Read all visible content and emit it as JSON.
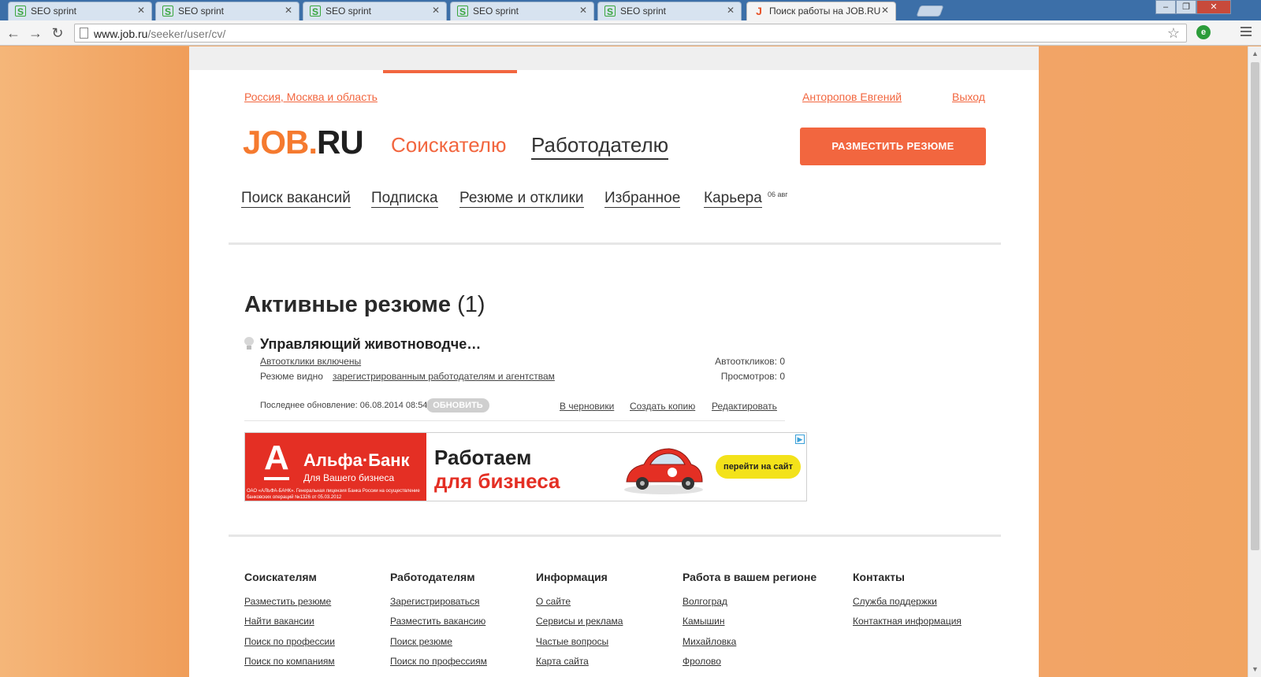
{
  "browser": {
    "tabs": [
      {
        "title": "SEO sprint",
        "favicon": "seosprint-icon"
      },
      {
        "title": "SEO sprint",
        "favicon": "seosprint-icon"
      },
      {
        "title": "SEO sprint",
        "favicon": "seosprint-icon"
      },
      {
        "title": "SEO sprint",
        "favicon": "seosprint-icon"
      },
      {
        "title": "SEO sprint",
        "favicon": "seosprint-icon"
      },
      {
        "title": "Поиск работы на JOB.RU",
        "favicon": "jobru-icon",
        "active": true
      }
    ],
    "url_host": "www.job.ru",
    "url_path": "/seeker/user/cv/"
  },
  "header": {
    "region": "Россия, Москва и область",
    "user_name": "Анторопов Евгений",
    "logout": "Выход",
    "logo_job": "JOB",
    "logo_dot": ".",
    "logo_ru": "RU",
    "nav_seeker": "Соискателю",
    "nav_employer": "Работодателю",
    "post_resume": "РАЗМЕСТИТЬ РЕЗЮМЕ"
  },
  "subnav": {
    "items": [
      "Поиск вакансий",
      "Подписка",
      "Резюме и отклики",
      "Избранное",
      "Карьера"
    ],
    "career_badge": "06 авг"
  },
  "main": {
    "section_title": "Активные резюме",
    "section_count": "(1)",
    "resume": {
      "title": "Управляющий животноводче…",
      "auto_responses": "Автоотклики включены",
      "visibility_prefix": "Резюме видно",
      "visibility_link": "зарегистрированным работодателям и агентствам",
      "auto_responses_count": "Автооткликов: 0",
      "views_count": "Просмотров: 0",
      "last_update": "Последнее обновление: 06.08.2014 08:54",
      "refresh": "ОБНОВИТЬ",
      "to_drafts": "В черновики",
      "copy": "Создать копию",
      "edit": "Редактировать"
    }
  },
  "ad": {
    "logo_letter": "А",
    "bank": "Альфа·Банк",
    "tagline": "Для Вашего бизнеса",
    "legal": "ОАО «АЛЬФА-БАНК». Генеральная лицензия Банка России на осуществление банковских операций №1326 от 05.03.2012",
    "headline1": "Работаем",
    "headline2": "для бизнеса",
    "cta": "перейти на сайт"
  },
  "footer": {
    "columns": [
      {
        "title": "Соискателям",
        "links": [
          "Разместить резюме",
          "Найти вакансии",
          "Поиск по профессии",
          "Поиск по компаниям"
        ]
      },
      {
        "title": "Работодателям",
        "links": [
          "Зарегистрироваться",
          "Разместить вакансию",
          "Поиск резюме",
          "Поиск по профессиям"
        ]
      },
      {
        "title": "Информация",
        "links": [
          "О сайте",
          "Сервисы и реклама",
          "Частые вопросы",
          "Карта сайта"
        ]
      },
      {
        "title": "Работа в вашем регионе",
        "links": [
          "Волгоград",
          "Камышин",
          "Михайловка",
          "Фролово"
        ]
      },
      {
        "title": "Контакты",
        "links": [
          "Служба поддержки",
          "Контактная информация"
        ]
      }
    ]
  },
  "colors": {
    "accent": "#f2663f",
    "logo_orange": "#f57a2f",
    "alfa_red": "#e42f24"
  }
}
